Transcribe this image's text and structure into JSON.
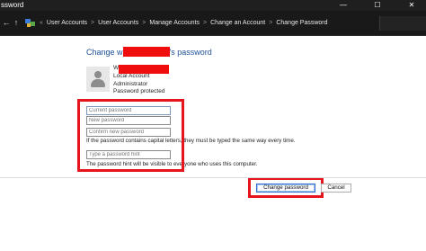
{
  "window": {
    "title": "ssword",
    "controls": {
      "minimize": "—",
      "maximize": "☐",
      "close": "✕"
    }
  },
  "navigation": {
    "back_icon": "arrow-left-icon",
    "up_icon": "arrow-up-icon",
    "breadcrumb": [
      "User Accounts",
      "User Accounts",
      "Manage Accounts",
      "Change an Account",
      "Change Password"
    ],
    "separator": ">",
    "root_separator": "«"
  },
  "page": {
    "heading_prefix": "Change w",
    "heading_suffix": "'s password",
    "account": {
      "name_initial": "W",
      "type": "Local Account",
      "role": "Administrator",
      "protection": "Password protected"
    },
    "fields": {
      "current_password_placeholder": "Current password",
      "new_password_placeholder": "New password",
      "confirm_password_placeholder": "Confirm new password",
      "hint_placeholder": "Type a password hint"
    },
    "caps_note": "If the password contains capital letters, they must be typed the same way every time.",
    "hint_note": "The password hint will be visible to everyone who uses this computer."
  },
  "actions": {
    "change_label": "Change password",
    "cancel_label": "Cancel"
  },
  "colors": {
    "heading": "#1c4e96",
    "redaction": "#ef0d0d",
    "highlight_box": "#e5141d",
    "titlebar": "#1f1f1f"
  }
}
